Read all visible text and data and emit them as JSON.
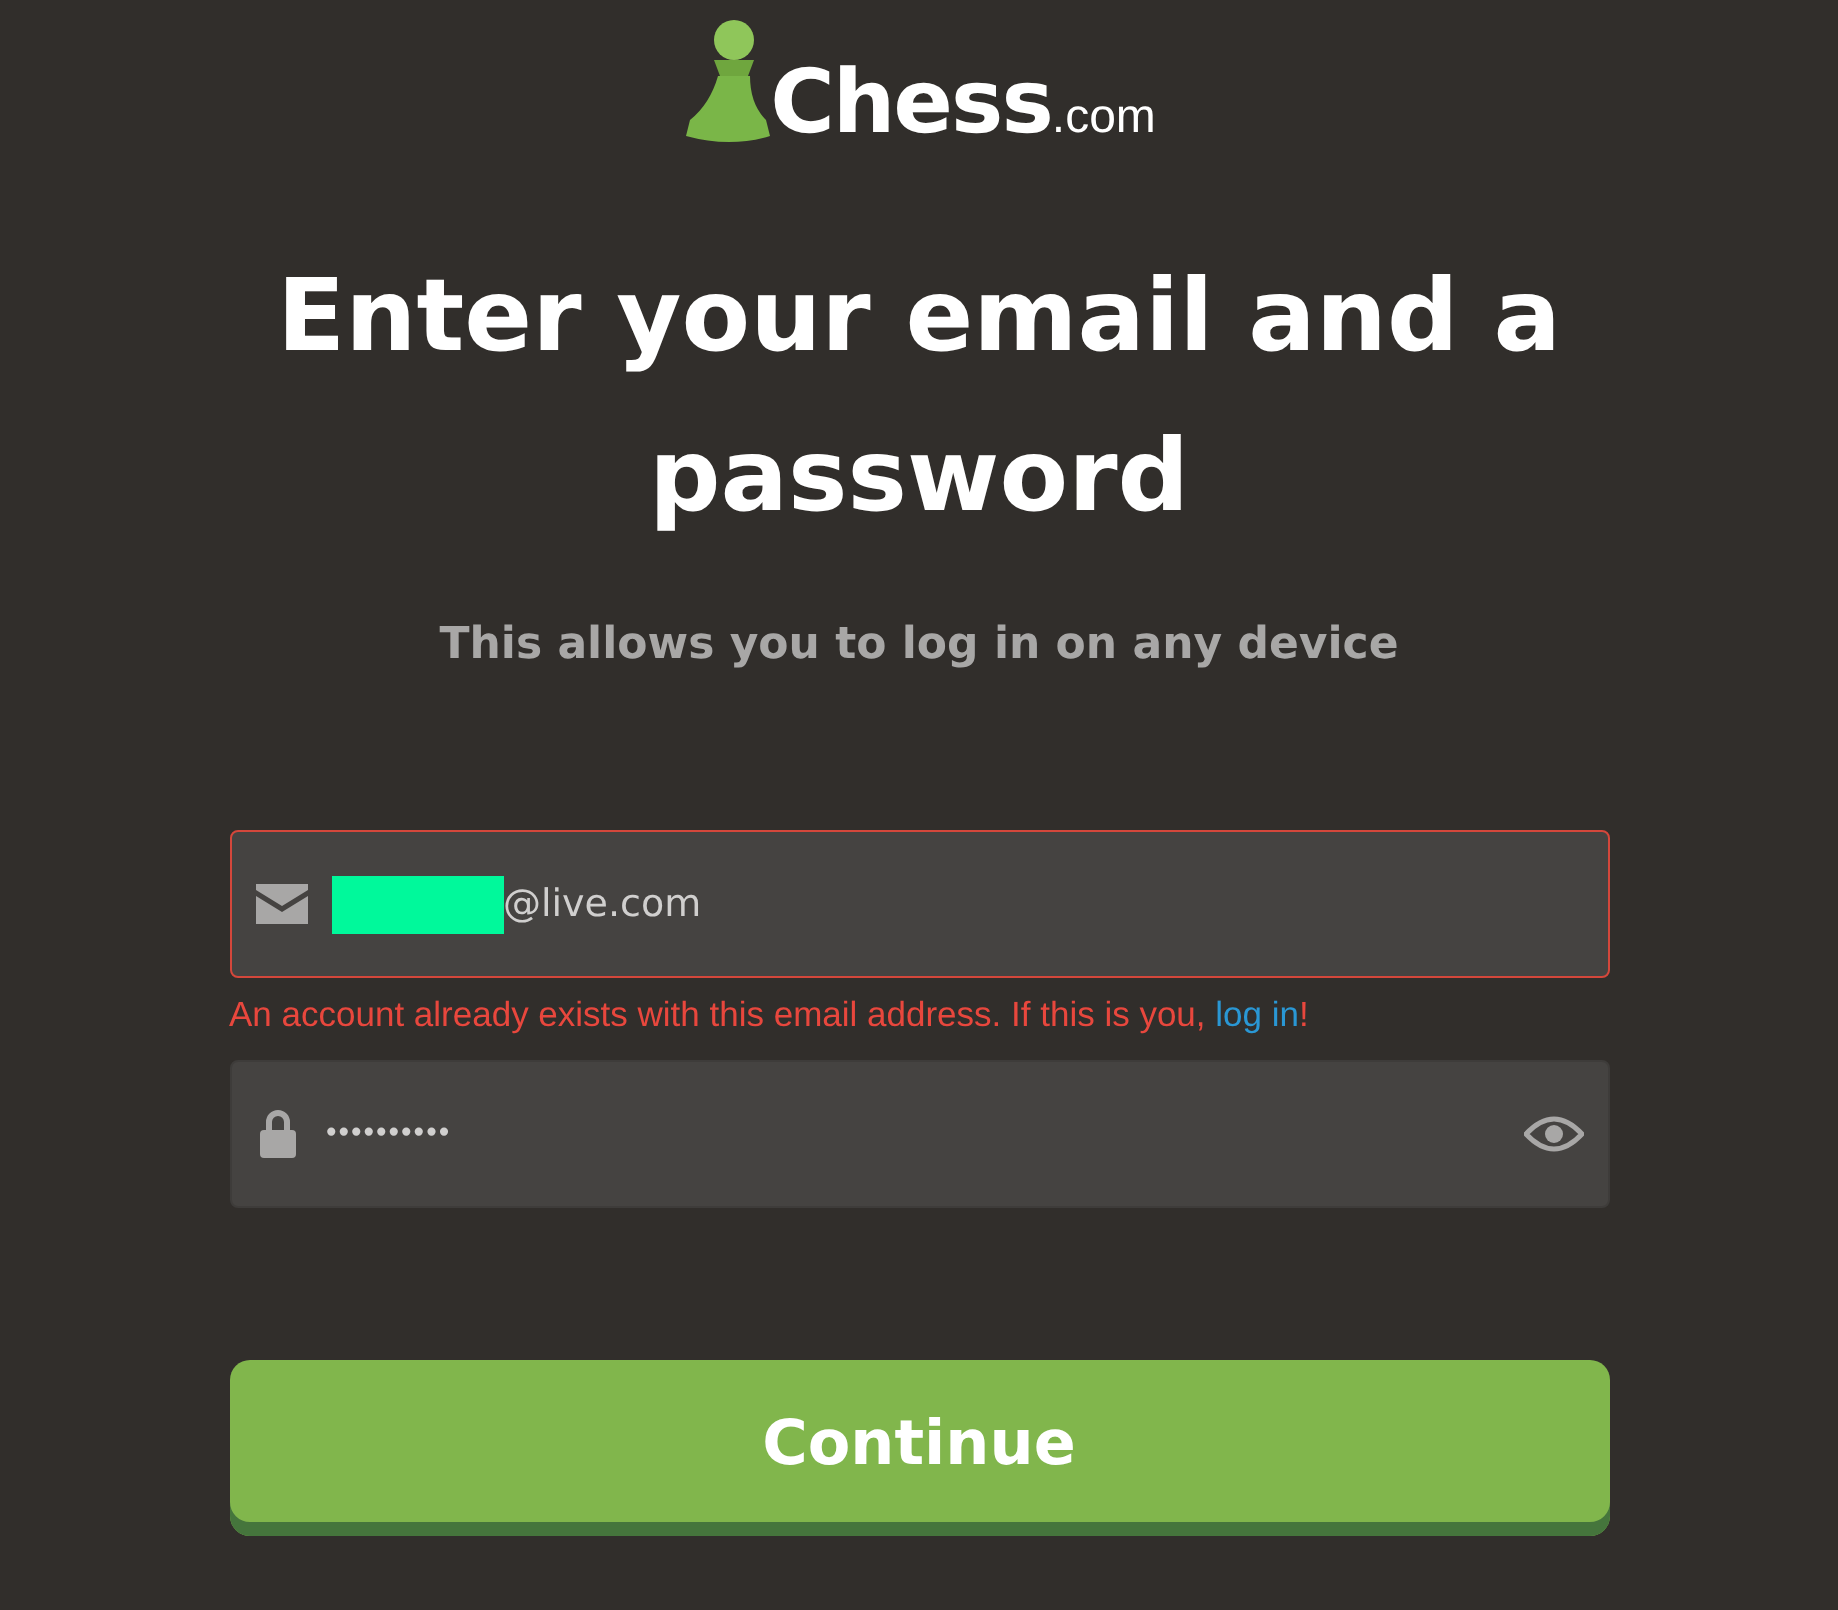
{
  "logo": {
    "name": "Chess",
    "suffix": ".com"
  },
  "title": "Enter your email and a password",
  "subtitle": "This allows you to log in on any device",
  "email_field": {
    "value": "@live.com",
    "redacted": true,
    "error": true
  },
  "error_message": {
    "text": "An account already exists with this email address. If this is you, ",
    "link": "log in",
    "end": "!"
  },
  "password_field": {
    "value": "••••••••••"
  },
  "continue_button": {
    "label": "Continue"
  }
}
